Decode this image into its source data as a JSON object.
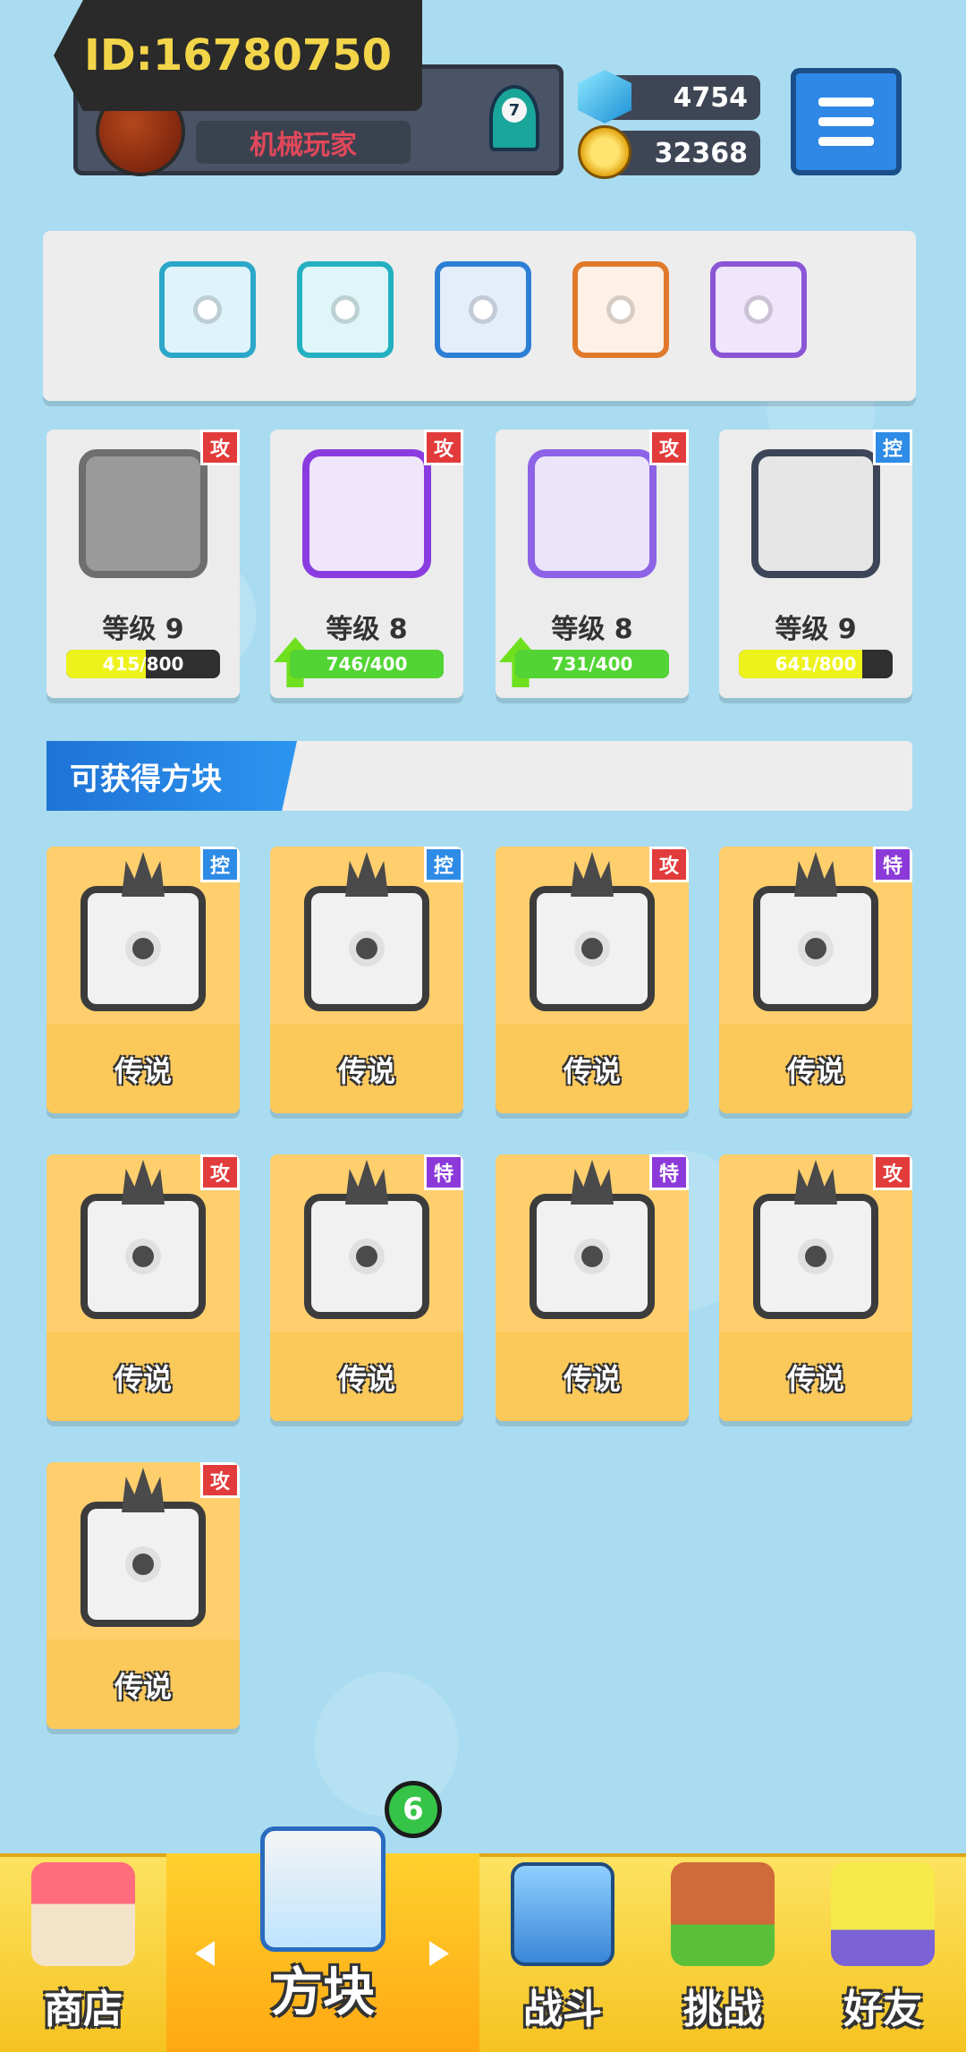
{
  "header": {
    "player_id": "ID:16780750",
    "nickname": "机械玩家",
    "rank": "7",
    "gems": "4754",
    "gold": "32368"
  },
  "deck_slots": [
    {
      "name": "vortex-dice",
      "color": "#2aa7c9"
    },
    {
      "name": "tech-dice",
      "color": "#23b0c0"
    },
    {
      "name": "snow-dice",
      "color": "#2d7fd6"
    },
    {
      "name": "infinity-dice",
      "color": "#e07a2a"
    },
    {
      "name": "purple-dice",
      "color": "#8a56d6"
    }
  ],
  "upgrade_cards": [
    {
      "tag": "攻",
      "tag_color": "red",
      "level": "等级 9",
      "progress": "415/800",
      "fill": 0.52,
      "fill_color": "#eef21c",
      "upgradable": false,
      "face": "#8f8f8f",
      "dot": "#3a78c8"
    },
    {
      "tag": "攻",
      "tag_color": "red",
      "level": "等级 8",
      "progress": "746/400",
      "fill": 1.0,
      "fill_color": "#52d534",
      "upgradable": true,
      "face": "#8a3ce0",
      "dot": "#6b3ad0"
    },
    {
      "tag": "攻",
      "tag_color": "red",
      "level": "等级 8",
      "progress": "731/400",
      "fill": 1.0,
      "fill_color": "#52d534",
      "upgradable": true,
      "face": "#8c63e6",
      "dot": "#6b3ad0"
    },
    {
      "tag": "控",
      "tag_color": "blue",
      "level": "等级 9",
      "progress": "641/800",
      "fill": 0.8,
      "fill_color": "#eef21c",
      "upgradable": false,
      "face": "#3d4658",
      "dot": "#2b2b2b"
    }
  ],
  "section": {
    "title": "可获得方块"
  },
  "legendary_cards": [
    {
      "tag": "控",
      "tag_color": "blue",
      "label": "传说"
    },
    {
      "tag": "控",
      "tag_color": "blue",
      "label": "传说"
    },
    {
      "tag": "攻",
      "tag_color": "red",
      "label": "传说"
    },
    {
      "tag": "特",
      "tag_color": "purple",
      "label": "传说"
    },
    {
      "tag": "攻",
      "tag_color": "red",
      "label": "传说"
    },
    {
      "tag": "特",
      "tag_color": "purple",
      "label": "传说"
    },
    {
      "tag": "特",
      "tag_color": "purple",
      "label": "传说"
    },
    {
      "tag": "攻",
      "tag_color": "red",
      "label": "传说"
    },
    {
      "tag": "攻",
      "tag_color": "red",
      "label": "传说"
    }
  ],
  "bottom_nav": [
    {
      "key": "shop",
      "label": "商店"
    },
    {
      "key": "dice",
      "label": "方块",
      "active": true,
      "badge": "6"
    },
    {
      "key": "battle",
      "label": "战斗"
    },
    {
      "key": "challenge",
      "label": "挑战"
    },
    {
      "key": "friends",
      "label": "好友"
    }
  ]
}
